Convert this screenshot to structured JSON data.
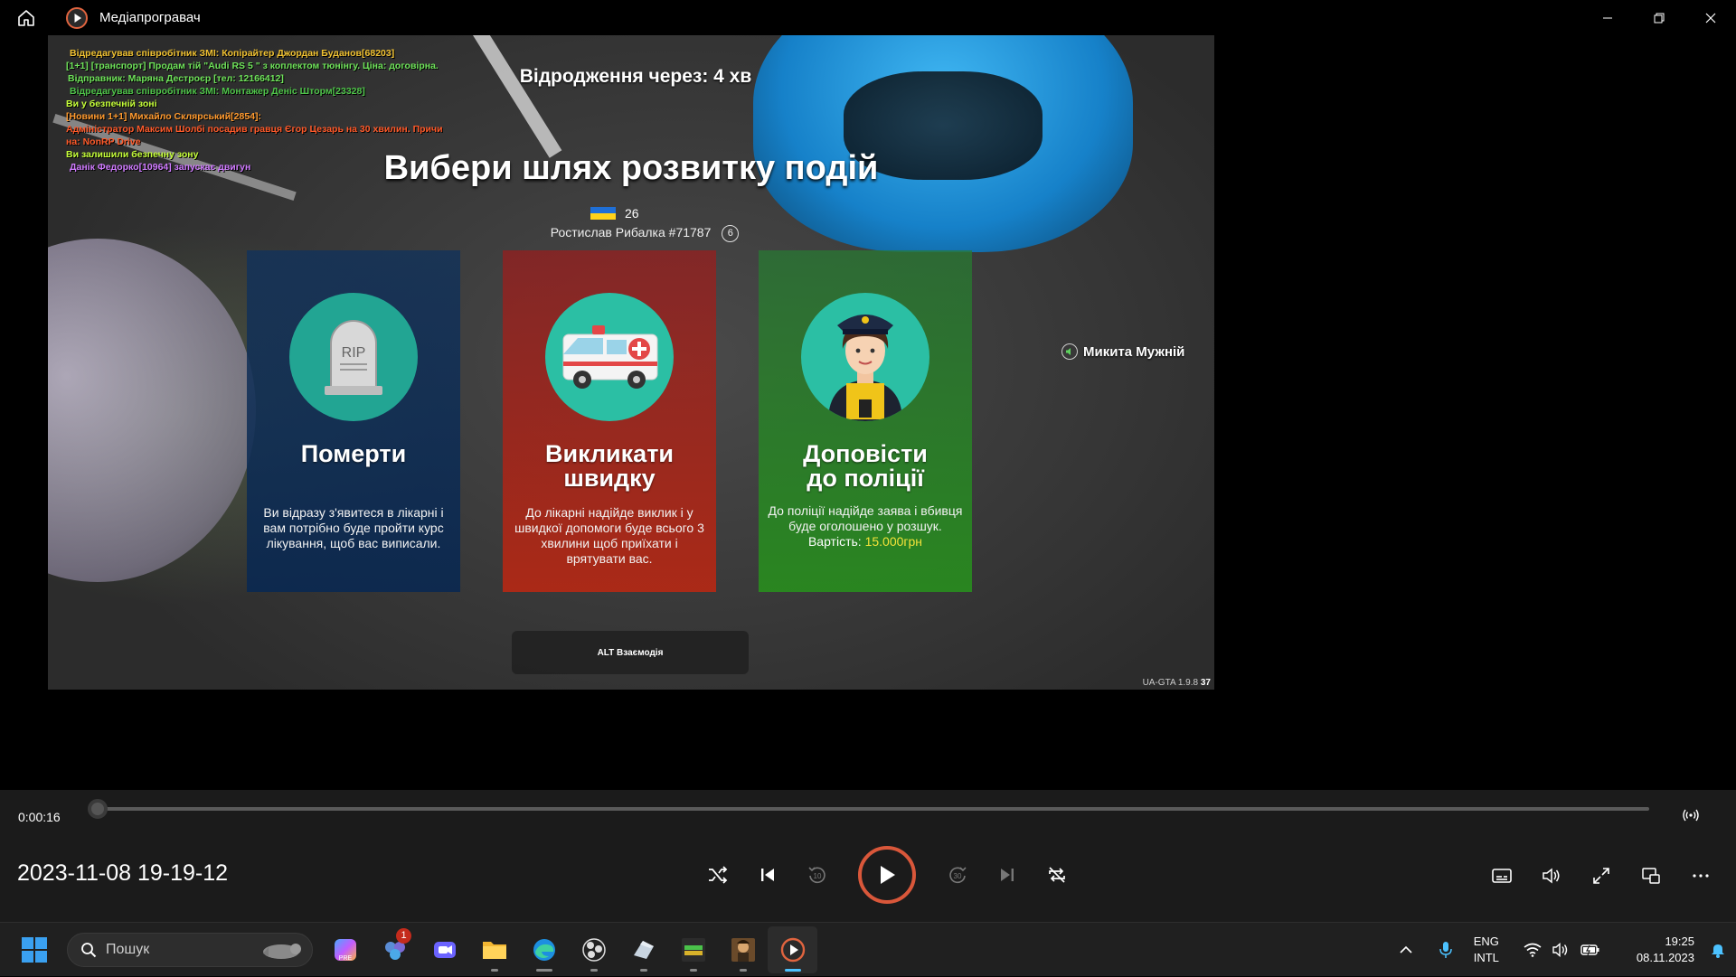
{
  "window": {
    "title": "Медіапрогравач"
  },
  "video": {
    "chat_lines": [
      {
        "text": "Відредагував співробітник ЗМІ: Копірайтер Джордан Буданов[68203]",
        "color": "#f1c232"
      },
      {
        "text": "[1+1] [транспорт] Продам тій \"Audi RS 5 \" з коплектом тюнінгу. Ціна: договірна.",
        "color": "#6fe35a"
      },
      {
        "text": "Відправник: Маряна Дестроєр [тел: 12166412]",
        "color": "#6fe35a"
      },
      {
        "text": "Відредагував співробітник ЗМІ: Монтажер Деніс Шторм[23328]",
        "color": "#6fe35a"
      },
      {
        "text": "Ви у безпечній зоні",
        "color": "#c6ff3a"
      },
      {
        "text": "[Новини 1+1] Михайло Склярський[2854]:",
        "color": "#ff9a2e"
      },
      {
        "text": "Адміністратор Максим Шолбі посадив гравця Єгор Цезарь на 30 хвилин. Причи",
        "color": "#ff5a2a"
      },
      {
        "text": "на: NonRP Drive",
        "color": "#ff5a2a"
      },
      {
        "text": "Ви залишили безпечну зону",
        "color": "#c6ff3a"
      },
      {
        "text": "Данік Федорко[10964] запускає двигун",
        "color": "#d07bff"
      }
    ],
    "respawn_text": "Відродження через: 4  хв",
    "heading": "Вибери шлях розвитку подій",
    "flag_count": "26",
    "player_name": "Ростислав Рибалка #71787",
    "player_level": "6",
    "cards": [
      {
        "icon": "tombstone-icon",
        "icon_text": "RIP",
        "title": "Померти",
        "description": "Ви відразу з'явитеся в лікарні і вам потрібно буде пройти курс лікування, щоб вас виписали."
      },
      {
        "icon": "ambulance-icon",
        "title": "Викликати швидку",
        "description": "До лікарні надійде виклик і у швидкої допомоги буде всього 3 хвилини щоб приїхати і врятувати вас."
      },
      {
        "icon": "police-officer-icon",
        "title": "Доповісти до поліції",
        "description": "До поліції надійде заява і вбивця буде оголошено у розшук.",
        "cost_label": "Вартість:",
        "cost_value": "15.000грн"
      }
    ],
    "speaker_name": "Микита Мужній",
    "alt_hint": "ALT Взаємодія",
    "version": "UA-GTA 1.9.8",
    "version_suffix": "37"
  },
  "player": {
    "current_time": "0:00:16",
    "progress_fraction": 0.0,
    "media_title": "2023-11-08 19-19-12"
  },
  "taskbar": {
    "search_placeholder": "Пошук",
    "teams_badge": "1",
    "lang_line1": "ENG",
    "lang_line2": "INTL",
    "time": "19:25",
    "date": "08.11.2023"
  },
  "colors": {
    "accent_play_ring": "#d9573a",
    "taskbar_active": "#4cc2ff",
    "cost_value": "#f3e23a"
  }
}
